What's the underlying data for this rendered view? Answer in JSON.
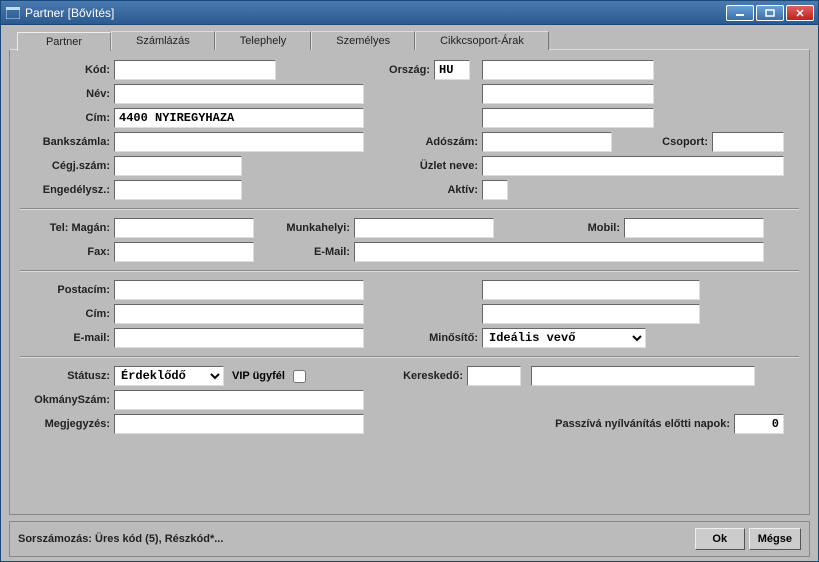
{
  "window": {
    "title": "Partner [Bővítés]"
  },
  "tabs": [
    "Partner",
    "Számlázás",
    "Telephely",
    "Személyes",
    "Cikkcsoport-Árak"
  ],
  "labels": {
    "kod": "Kód:",
    "nev": "Név:",
    "cim": "Cím:",
    "bankszamla": "Bankszámla:",
    "cegjsz": "Cégj.szám:",
    "engedely": "Engedélysz.:",
    "orszag": "Ország:",
    "adoszam": "Adószám:",
    "csoport": "Csoport:",
    "uzletneve": "Üzlet neve:",
    "aktiv": "Aktív:",
    "telmagan": "Tel: Magán:",
    "munkahelyi": "Munkahelyi:",
    "mobil": "Mobil:",
    "fax": "Fax:",
    "email": "E-Mail:",
    "postacim": "Postacím:",
    "cim2": "Cím:",
    "email2": "E-mail:",
    "minosito": "Minősítő:",
    "status": "Státusz:",
    "vip": "VIP ügyfél",
    "kereskedo": "Kereskedő:",
    "okmanysz": "OkmánySzám:",
    "megjegyzes": "Megjegyzés:",
    "passziva": "Passzívá nyílvánítás előtti napok:"
  },
  "values": {
    "kod": "",
    "nev": "",
    "cim": "4400 NYIREGYHAZA",
    "orszag": "HU",
    "orszagname": "",
    "cimextra": "",
    "nevextra": "",
    "bankszamla": "",
    "cegjsz": "",
    "engedely": "",
    "adoszam": "",
    "csoport": "",
    "uzletneve": "",
    "aktiv": "",
    "telmagan": "",
    "munkahelyi": "",
    "mobil": "",
    "fax": "",
    "email": "",
    "postacim": "",
    "postacimextra": "",
    "cim2": "",
    "cim2extra": "",
    "email2": "",
    "minosito": "Ideális vevő",
    "status": "Érdeklődő",
    "vip": false,
    "kereskedo1": "",
    "kereskedo2": "",
    "okmanysz": "",
    "megjegyzes": "",
    "passziva": "0"
  },
  "footer": {
    "status": "Sorszámozás: Üres kód (5), Részkód*...",
    "ok": "Ok",
    "cancel": "Mégse"
  }
}
